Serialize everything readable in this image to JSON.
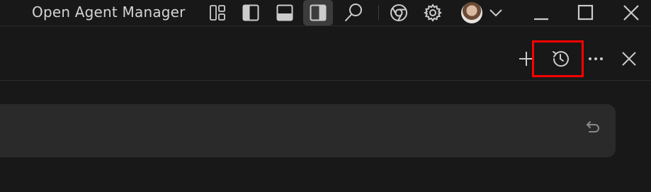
{
  "titlebar": {
    "title": "Open Agent Manager",
    "icons": [
      "customize-layout-icon",
      "toggle-primary-sidebar-icon",
      "toggle-panel-icon",
      "toggle-secondary-sidebar-icon",
      "search-icon",
      "chrome-icon",
      "settings-gear-icon",
      "account-avatar",
      "chevron-down-icon",
      "minimize-icon",
      "maximize-icon",
      "close-window-icon"
    ],
    "active_layout_toggle": "toggle-secondary-sidebar-icon"
  },
  "panel_toolbar": {
    "actions": [
      "new-chat-icon",
      "history-icon",
      "more-actions-icon",
      "close-panel-icon"
    ],
    "highlighted_action": "history-icon"
  },
  "chat_input": {
    "value": "",
    "icon": "undo-icon"
  },
  "colors": {
    "background": "#181818",
    "input_background": "#2a2a2a",
    "highlight": "#ff0000",
    "icon": "#cccccc"
  }
}
